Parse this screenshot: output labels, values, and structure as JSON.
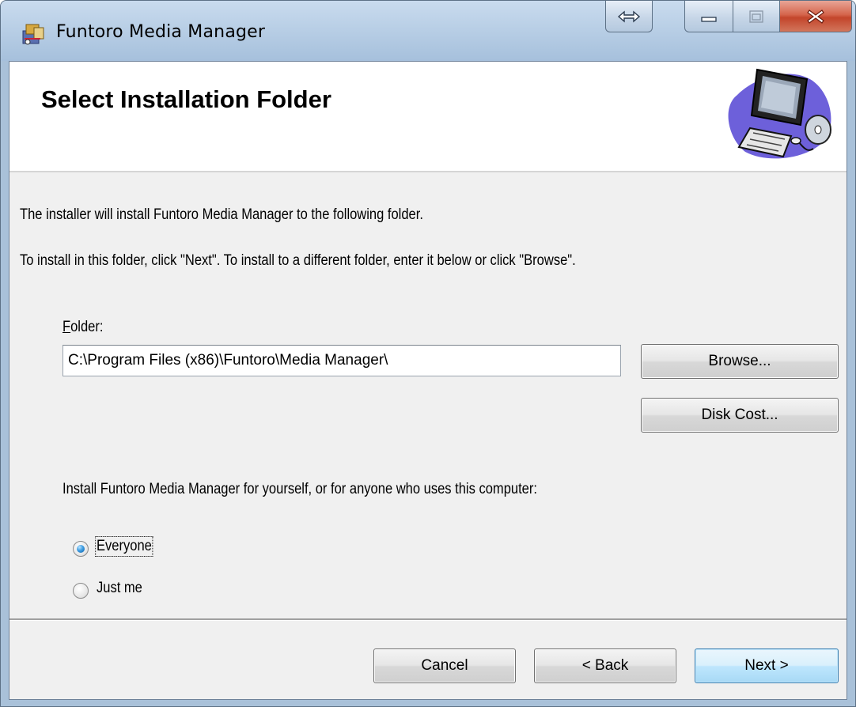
{
  "window": {
    "title": "Funtoro Media Manager"
  },
  "banner": {
    "title": "Select Installation Folder"
  },
  "body": {
    "intro": "The installer will install Funtoro Media Manager to the following folder.",
    "instructions": "To install in this folder, click \"Next\". To install to a different folder, enter it below or click \"Browse\".",
    "folder_label": "Folder:",
    "folder_value": "C:\\Program Files (x86)\\Funtoro\\Media Manager\\",
    "install_for": "Install Funtoro Media Manager for yourself, or for anyone who uses this computer:"
  },
  "buttons": {
    "browse": "Browse...",
    "disk_cost": "Disk Cost...",
    "cancel": "Cancel",
    "back": "< Back",
    "next": "Next >"
  },
  "radio": {
    "everyone": "Everyone",
    "just_me": "Just me",
    "selected": "Everyone"
  },
  "icons": {
    "title": "installer-package-icon",
    "resize": "double-arrow-icon",
    "minimize": "minimize-icon",
    "maximize": "maximize-icon",
    "close": "close-icon",
    "banner": "computer-with-cd-icon"
  },
  "colors": {
    "titlebar": "#b9cfe6",
    "close_button": "#c3452b",
    "default_button": "#bee6fd",
    "radio_selected": "#3f9de2"
  }
}
